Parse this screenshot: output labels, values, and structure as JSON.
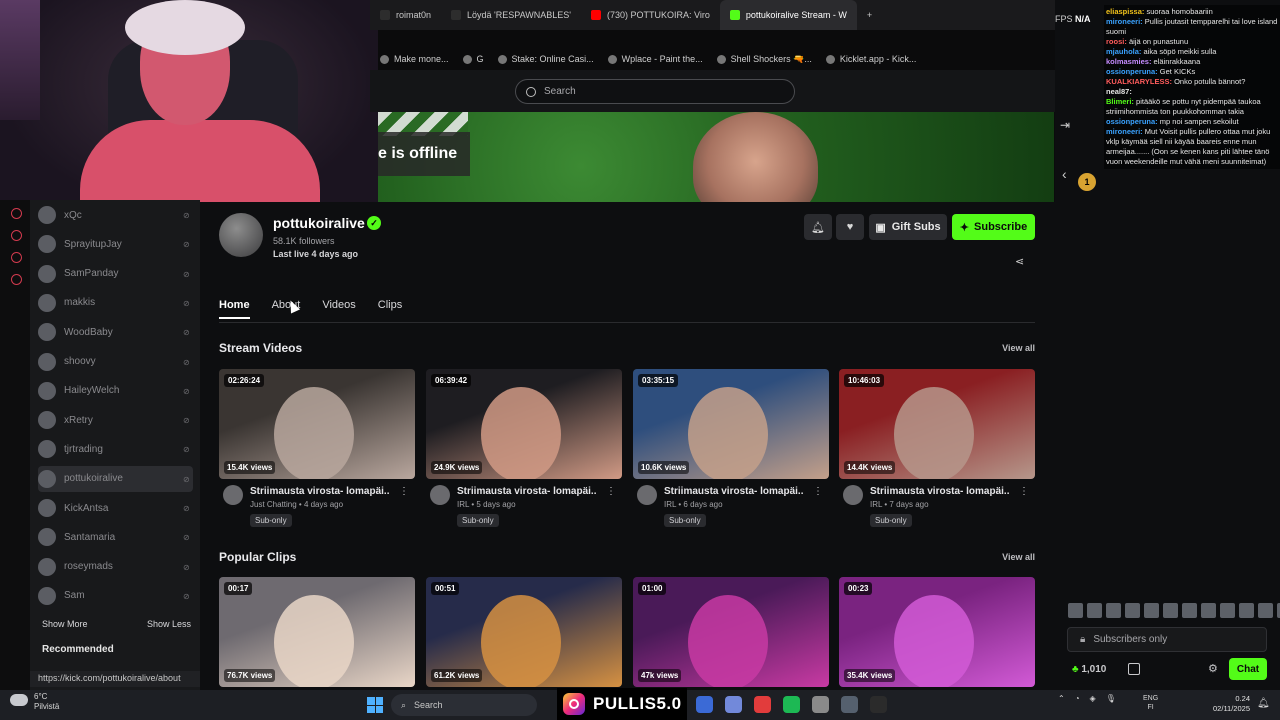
{
  "browser": {
    "tabs": [
      {
        "label": "roimat0n",
        "color": "#2d2d2d"
      },
      {
        "label": "Löydä 'RESPAWNABLES'",
        "color": "#2d2d2d"
      },
      {
        "label": "(730) POTTUKOIRA: Viro",
        "color": "#ff0000"
      },
      {
        "label": "pottukoiralive Stream - W",
        "color": "#53fc18",
        "active": true
      }
    ],
    "new_tab_icon": "+",
    "bookmarks": [
      "Make mone...",
      "G",
      "Stake: Online Casi...",
      "Wplace - Paint the...",
      "Shell Shockers 🔫...",
      "Kicklet.app - Kick..."
    ]
  },
  "search": {
    "placeholder": "Search"
  },
  "banner": {
    "offline_text": "e is offline"
  },
  "sidebar": {
    "items": [
      {
        "name": "xQc"
      },
      {
        "name": "SprayitupJay"
      },
      {
        "name": "SamPanday"
      },
      {
        "name": "makkis"
      },
      {
        "name": "WoodBaby"
      },
      {
        "name": "shoovy"
      },
      {
        "name": "HaileyWelch"
      },
      {
        "name": "xRetry"
      },
      {
        "name": "tjrtrading"
      },
      {
        "name": "pottukoiralive",
        "selected": true
      },
      {
        "name": "KickAntsa"
      },
      {
        "name": "Santamaria"
      },
      {
        "name": "roseymads"
      },
      {
        "name": "Sam"
      }
    ],
    "show_more": "Show More",
    "show_less": "Show Less",
    "recommended": "Recommended",
    "status_url": "https://kick.com/pottukoiralive/about"
  },
  "channel": {
    "name": "pottukoiralive",
    "followers": "58.1K followers",
    "last_live": "Last live 4 days ago",
    "gift_label": "Gift Subs",
    "subscribe_label": "Subscribe",
    "tabs": [
      "Home",
      "About",
      "Videos",
      "Clips"
    ]
  },
  "stream_videos": {
    "title": "Stream Videos",
    "view_all": "View all",
    "items": [
      {
        "duration": "02:26:24",
        "views": "15.4K views",
        "title": "Striimausta virosta- lomapäi...",
        "meta": "Just Chatting • 4 days ago",
        "badge": "Sub-only",
        "c1": "#b9a79e",
        "c2": "#3a3532"
      },
      {
        "duration": "06:39:42",
        "views": "24.9K views",
        "title": "Striimausta virosta- lomapäi...",
        "meta": "IRL • 5 days ago",
        "badge": "Sub-only",
        "c1": "#d19a85",
        "c2": "#1e1d21"
      },
      {
        "duration": "03:35:15",
        "views": "10.6K views",
        "title": "Striimausta virosta- lomapäi...",
        "meta": "IRL • 6 days ago",
        "badge": "Sub-only",
        "c1": "#c4a08a",
        "c2": "#2e4e7d"
      },
      {
        "duration": "10:46:03",
        "views": "14.4K views",
        "title": "Striimausta virosta- lomapäi...",
        "meta": "IRL • 7 days ago",
        "badge": "Sub-only",
        "c1": "#b6978b",
        "c2": "#8a1f22"
      }
    ]
  },
  "popular_clips": {
    "title": "Popular Clips",
    "view_all": "View all",
    "items": [
      {
        "duration": "00:17",
        "views": "76.7K views",
        "c1": "#e9d6c7",
        "c2": "#6e6a70"
      },
      {
        "duration": "00:51",
        "views": "61.2K views",
        "c1": "#d69142",
        "c2": "#262b4a"
      },
      {
        "duration": "01:00",
        "views": "47k views",
        "c1": "#c83aa3",
        "c2": "#4a1a58"
      },
      {
        "duration": "00:23",
        "views": "35.4K views",
        "c1": "#d25ad6",
        "c2": "#7a2380"
      }
    ]
  },
  "overlay": {
    "fps_label": "FPS",
    "fps_value": "N/A"
  },
  "chat": {
    "messages": [
      {
        "user": "eliaspissa:",
        "text": "suoraa homobaariin",
        "color": "#f1c21b"
      },
      {
        "user": "mironeeri:",
        "text": "Pullis joutasit tempparelhi tai love island suomi",
        "color": "#3aa2ff"
      },
      {
        "user": "roosi:",
        "text": "äijä on punastunu",
        "color": "#ff5c5c"
      },
      {
        "user": "mjauhola:",
        "text": "aika söpö meikki sulla",
        "color": "#3aa2ff"
      },
      {
        "user": "kolmasmies:",
        "text": "eläinrakkaana",
        "color": "#c58cff"
      },
      {
        "user": "ossionperuna:",
        "text": "Get KICKs",
        "color": "#3aa2ff"
      },
      {
        "user": "KUALKIARYLESS:",
        "text": "Onko potulla bännot?",
        "color": "#ff5c5c"
      },
      {
        "user": "neal87:",
        "text": "",
        "color": "#e6e6e6"
      },
      {
        "user": "Blimeri:",
        "text": "pitääkö se pottu nyt pidempää taukoa striimihommista ton puukkohomman takia",
        "color": "#53fc18"
      },
      {
        "user": "ossionperuna:",
        "text": "mp noi sampen sekoilut",
        "color": "#3aa2ff"
      },
      {
        "user": "mironeeri:",
        "text": "Mut Voisit pullis pullero ottaa mut joku vklp käymää siell nii käyää baareis enne mun armeijaa....... (Oon se kenen kans piti lähtee tänö vuon weekendeille mut vähä meni suunniteimat)",
        "color": "#3aa2ff"
      }
    ],
    "input_placeholder": "Subscribers only",
    "kicks_count": "1,010",
    "chat_button": "Chat"
  },
  "taskbar": {
    "temp": "6°C",
    "weather": "Pilvistä",
    "search_placeholder": "Search",
    "promo_text": "PULLIS5.0",
    "lang_1": "ENG",
    "lang_2": "FI",
    "time": "0.24",
    "date": "02/11/2025"
  }
}
